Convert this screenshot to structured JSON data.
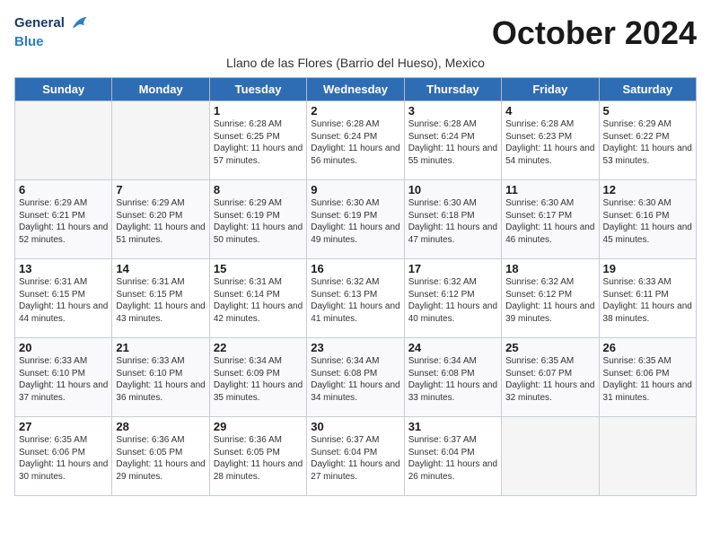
{
  "header": {
    "logo_general": "General",
    "logo_blue": "Blue",
    "month_title": "October 2024",
    "subtitle": "Llano de las Flores (Barrio del Hueso), Mexico"
  },
  "weekdays": [
    "Sunday",
    "Monday",
    "Tuesday",
    "Wednesday",
    "Thursday",
    "Friday",
    "Saturday"
  ],
  "weeks": [
    [
      {
        "day": "",
        "info": ""
      },
      {
        "day": "",
        "info": ""
      },
      {
        "day": "1",
        "info": "Sunrise: 6:28 AM\nSunset: 6:25 PM\nDaylight: 11 hours and 57 minutes."
      },
      {
        "day": "2",
        "info": "Sunrise: 6:28 AM\nSunset: 6:24 PM\nDaylight: 11 hours and 56 minutes."
      },
      {
        "day": "3",
        "info": "Sunrise: 6:28 AM\nSunset: 6:24 PM\nDaylight: 11 hours and 55 minutes."
      },
      {
        "day": "4",
        "info": "Sunrise: 6:28 AM\nSunset: 6:23 PM\nDaylight: 11 hours and 54 minutes."
      },
      {
        "day": "5",
        "info": "Sunrise: 6:29 AM\nSunset: 6:22 PM\nDaylight: 11 hours and 53 minutes."
      }
    ],
    [
      {
        "day": "6",
        "info": "Sunrise: 6:29 AM\nSunset: 6:21 PM\nDaylight: 11 hours and 52 minutes."
      },
      {
        "day": "7",
        "info": "Sunrise: 6:29 AM\nSunset: 6:20 PM\nDaylight: 11 hours and 51 minutes."
      },
      {
        "day": "8",
        "info": "Sunrise: 6:29 AM\nSunset: 6:19 PM\nDaylight: 11 hours and 50 minutes."
      },
      {
        "day": "9",
        "info": "Sunrise: 6:30 AM\nSunset: 6:19 PM\nDaylight: 11 hours and 49 minutes."
      },
      {
        "day": "10",
        "info": "Sunrise: 6:30 AM\nSunset: 6:18 PM\nDaylight: 11 hours and 47 minutes."
      },
      {
        "day": "11",
        "info": "Sunrise: 6:30 AM\nSunset: 6:17 PM\nDaylight: 11 hours and 46 minutes."
      },
      {
        "day": "12",
        "info": "Sunrise: 6:30 AM\nSunset: 6:16 PM\nDaylight: 11 hours and 45 minutes."
      }
    ],
    [
      {
        "day": "13",
        "info": "Sunrise: 6:31 AM\nSunset: 6:15 PM\nDaylight: 11 hours and 44 minutes."
      },
      {
        "day": "14",
        "info": "Sunrise: 6:31 AM\nSunset: 6:15 PM\nDaylight: 11 hours and 43 minutes."
      },
      {
        "day": "15",
        "info": "Sunrise: 6:31 AM\nSunset: 6:14 PM\nDaylight: 11 hours and 42 minutes."
      },
      {
        "day": "16",
        "info": "Sunrise: 6:32 AM\nSunset: 6:13 PM\nDaylight: 11 hours and 41 minutes."
      },
      {
        "day": "17",
        "info": "Sunrise: 6:32 AM\nSunset: 6:12 PM\nDaylight: 11 hours and 40 minutes."
      },
      {
        "day": "18",
        "info": "Sunrise: 6:32 AM\nSunset: 6:12 PM\nDaylight: 11 hours and 39 minutes."
      },
      {
        "day": "19",
        "info": "Sunrise: 6:33 AM\nSunset: 6:11 PM\nDaylight: 11 hours and 38 minutes."
      }
    ],
    [
      {
        "day": "20",
        "info": "Sunrise: 6:33 AM\nSunset: 6:10 PM\nDaylight: 11 hours and 37 minutes."
      },
      {
        "day": "21",
        "info": "Sunrise: 6:33 AM\nSunset: 6:10 PM\nDaylight: 11 hours and 36 minutes."
      },
      {
        "day": "22",
        "info": "Sunrise: 6:34 AM\nSunset: 6:09 PM\nDaylight: 11 hours and 35 minutes."
      },
      {
        "day": "23",
        "info": "Sunrise: 6:34 AM\nSunset: 6:08 PM\nDaylight: 11 hours and 34 minutes."
      },
      {
        "day": "24",
        "info": "Sunrise: 6:34 AM\nSunset: 6:08 PM\nDaylight: 11 hours and 33 minutes."
      },
      {
        "day": "25",
        "info": "Sunrise: 6:35 AM\nSunset: 6:07 PM\nDaylight: 11 hours and 32 minutes."
      },
      {
        "day": "26",
        "info": "Sunrise: 6:35 AM\nSunset: 6:06 PM\nDaylight: 11 hours and 31 minutes."
      }
    ],
    [
      {
        "day": "27",
        "info": "Sunrise: 6:35 AM\nSunset: 6:06 PM\nDaylight: 11 hours and 30 minutes."
      },
      {
        "day": "28",
        "info": "Sunrise: 6:36 AM\nSunset: 6:05 PM\nDaylight: 11 hours and 29 minutes."
      },
      {
        "day": "29",
        "info": "Sunrise: 6:36 AM\nSunset: 6:05 PM\nDaylight: 11 hours and 28 minutes."
      },
      {
        "day": "30",
        "info": "Sunrise: 6:37 AM\nSunset: 6:04 PM\nDaylight: 11 hours and 27 minutes."
      },
      {
        "day": "31",
        "info": "Sunrise: 6:37 AM\nSunset: 6:04 PM\nDaylight: 11 hours and 26 minutes."
      },
      {
        "day": "",
        "info": ""
      },
      {
        "day": "",
        "info": ""
      }
    ]
  ]
}
